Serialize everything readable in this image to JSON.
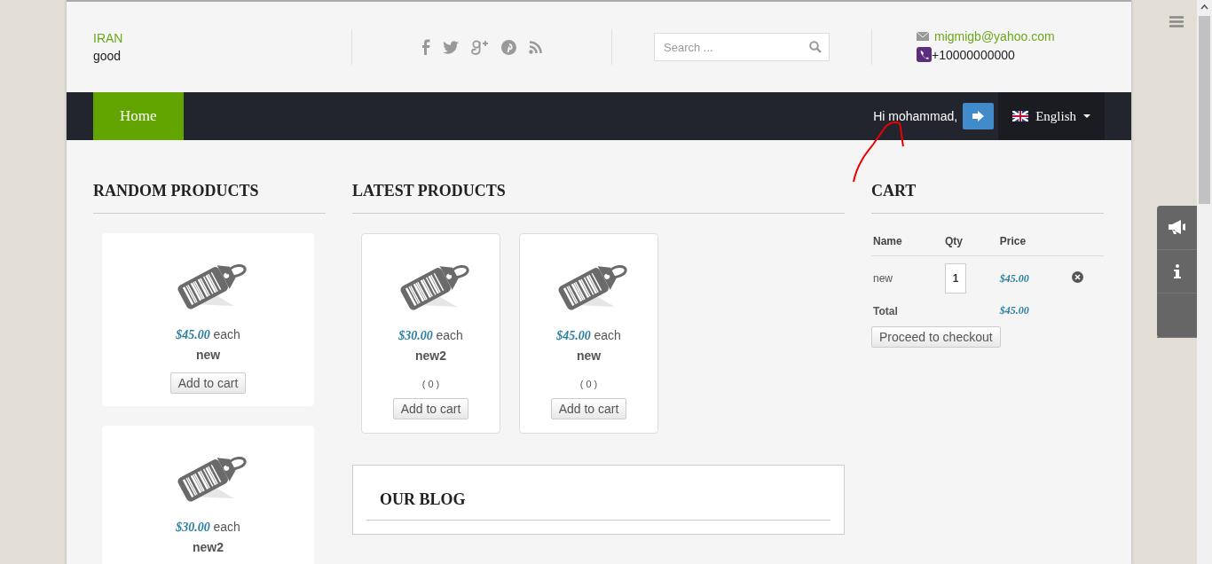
{
  "header": {
    "location": "IRAN",
    "tagline": "good",
    "search": {
      "placeholder": "Search ..."
    },
    "email": "migmigb@yahoo.com",
    "phone": "+10000000000"
  },
  "nav": {
    "items": [
      {
        "label": "Home",
        "selected": true
      }
    ],
    "greeting": "Hi mohammad,",
    "language": "English"
  },
  "random_products": {
    "title": "RANDOM PRODUCTS",
    "items": [
      {
        "price": "$45.00",
        "unit": "each",
        "name": "new",
        "button": "Add to cart"
      },
      {
        "price": "$30.00",
        "unit": "each",
        "name": "new2"
      }
    ]
  },
  "latest_products": {
    "title": "LATEST PRODUCTS",
    "items": [
      {
        "price": "$30.00",
        "unit": "each",
        "name": "new2",
        "rating": "( 0 )",
        "button": "Add to cart"
      },
      {
        "price": "$45.00",
        "unit": "each",
        "name": "new",
        "rating": "( 0 )",
        "button": "Add to cart"
      }
    ]
  },
  "blog": {
    "title": "OUR BLOG"
  },
  "cart": {
    "title": "CART",
    "columns": [
      "Name",
      "Qty",
      "Price"
    ],
    "rows": [
      {
        "name": "new",
        "qty": "1",
        "price": "$45.00"
      }
    ],
    "total_label": "Total",
    "total": "$45.00",
    "checkout_button": "Proceed to checkout"
  }
}
